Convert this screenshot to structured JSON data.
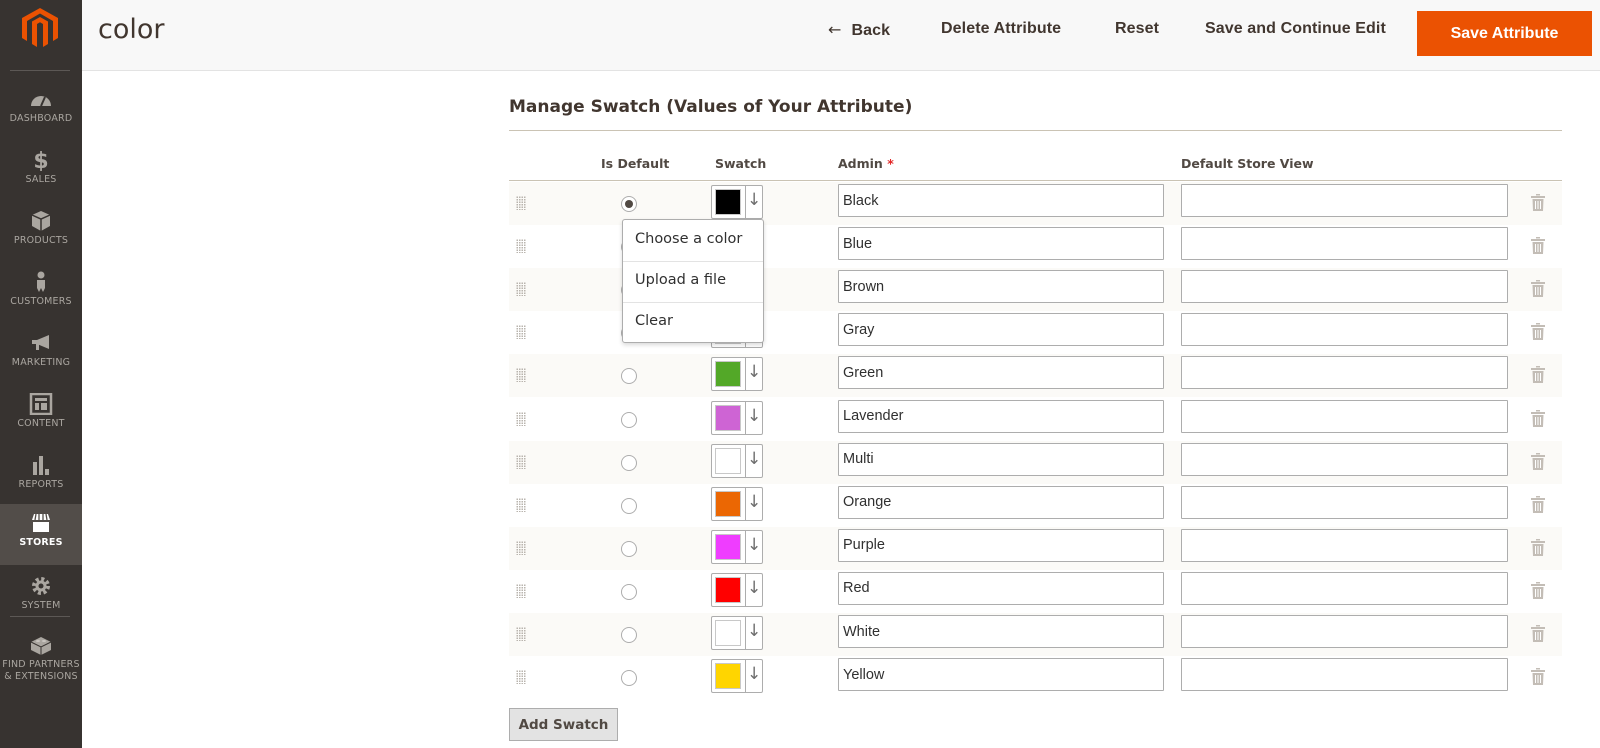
{
  "sidebar": {
    "items": [
      {
        "id": "dashboard",
        "label": "DASHBOARD",
        "icon": "dashboard-gauge-icon"
      },
      {
        "id": "sales",
        "label": "SALES",
        "icon": "dollar-icon"
      },
      {
        "id": "products",
        "label": "PRODUCTS",
        "icon": "box-icon"
      },
      {
        "id": "customers",
        "label": "CUSTOMERS",
        "icon": "person-icon"
      },
      {
        "id": "marketing",
        "label": "MARKETING",
        "icon": "megaphone-icon"
      },
      {
        "id": "content",
        "label": "CONTENT",
        "icon": "layout-icon"
      },
      {
        "id": "reports",
        "label": "REPORTS",
        "icon": "bar-chart-icon"
      },
      {
        "id": "stores",
        "label": "STORES",
        "icon": "storefront-icon",
        "active": true
      },
      {
        "id": "system",
        "label": "SYSTEM",
        "icon": "gear-icon"
      },
      {
        "id": "partners",
        "label": "FIND PARTNERS & EXTENSIONS",
        "icon": "lego-block-icon"
      }
    ]
  },
  "header": {
    "title": "color",
    "back_label": "Back",
    "delete_label": "Delete Attribute",
    "reset_label": "Reset",
    "save_continue_label": "Save and Continue Edit",
    "save_label": "Save Attribute"
  },
  "colors": {
    "accent": "#eb5202",
    "sidebar_bg": "#373330",
    "sidebar_active": "#524d49"
  },
  "section": {
    "title": "Manage Swatch (Values of Your Attribute)",
    "columns": {
      "is_default": "Is Default",
      "swatch": "Swatch",
      "admin": "Admin",
      "admin_required": "*",
      "store_view": "Default Store View"
    },
    "rows": [
      {
        "admin": "Black",
        "store": "",
        "color": "#000000",
        "default": true
      },
      {
        "admin": "Blue",
        "store": "",
        "color": "#1857f7",
        "default": false
      },
      {
        "admin": "Brown",
        "store": "",
        "color": "#945454",
        "default": false
      },
      {
        "admin": "Gray",
        "store": "",
        "color": "#8f8f8f",
        "default": false
      },
      {
        "admin": "Green",
        "store": "",
        "color": "#53a828",
        "default": false
      },
      {
        "admin": "Lavender",
        "store": "",
        "color": "#ce64d4",
        "default": false
      },
      {
        "admin": "Multi",
        "store": "",
        "color": "#ffffff",
        "default": false
      },
      {
        "admin": "Orange",
        "store": "",
        "color": "#eb6703",
        "default": false
      },
      {
        "admin": "Purple",
        "store": "",
        "color": "#ef3dff",
        "default": false
      },
      {
        "admin": "Red",
        "store": "",
        "color": "#ff0000",
        "default": false
      },
      {
        "admin": "White",
        "store": "",
        "color": "#ffffff",
        "default": false
      },
      {
        "admin": "Yellow",
        "store": "",
        "color": "#ffd500",
        "default": false
      }
    ],
    "swatch_menu": {
      "items": [
        "Choose a color",
        "Upload a file",
        "Clear"
      ]
    },
    "add_button": "Add Swatch"
  }
}
